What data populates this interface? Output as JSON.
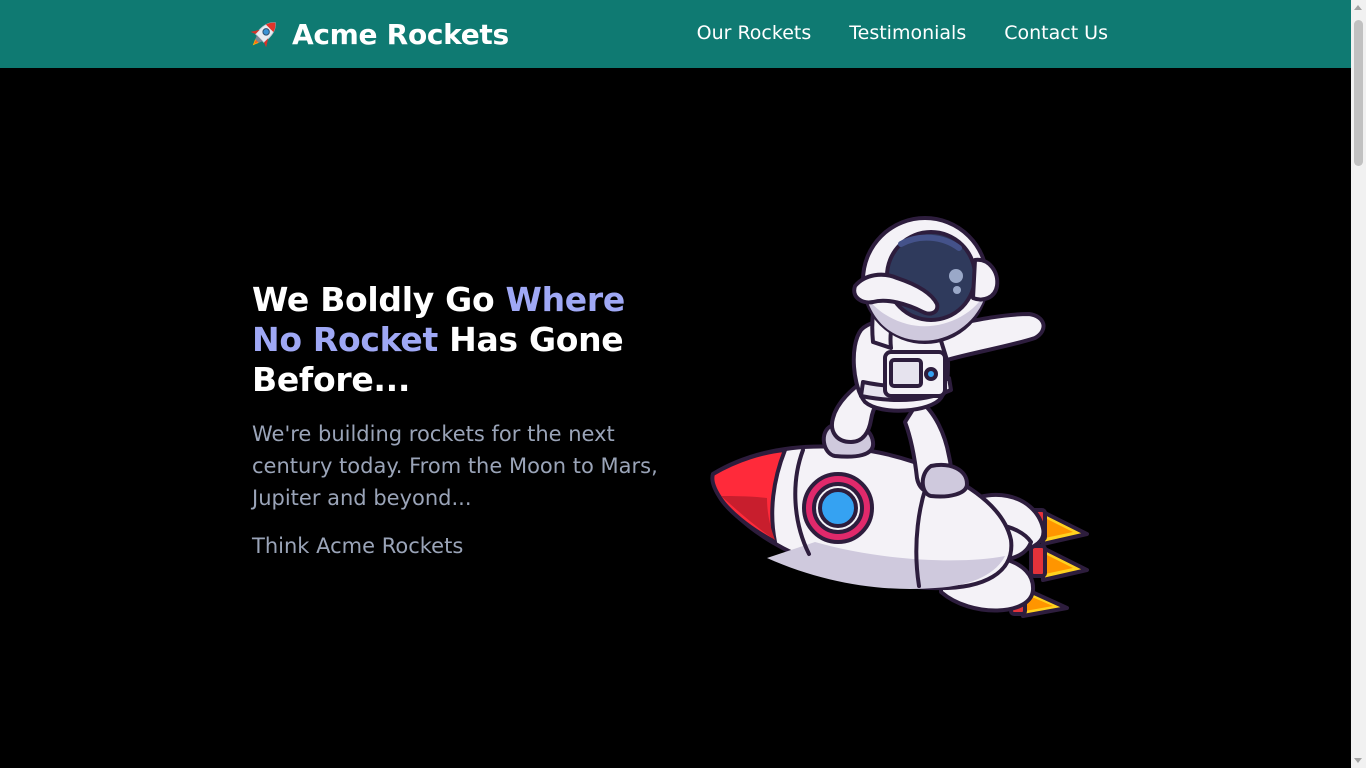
{
  "brand": {
    "name": "Acme Rockets",
    "icon": "rocket-icon"
  },
  "nav": {
    "items": [
      {
        "label": "Our Rockets"
      },
      {
        "label": "Testimonials"
      },
      {
        "label": "Contact Us"
      }
    ]
  },
  "hero": {
    "title_part1": "We Boldly Go ",
    "title_accent": "Where No Rocket",
    "title_part2": " Has Gone Before...",
    "description": "We're building rockets for the next century today. From the Moon to Mars, Jupiter and beyond...",
    "tagline": "Think Acme Rockets",
    "illustration": "astronaut-on-rocket-illustration"
  },
  "colors": {
    "header_bg": "#0f7a72",
    "page_bg": "#000000",
    "accent_text": "#9fa8f5",
    "muted_text": "#9aa4b8"
  }
}
